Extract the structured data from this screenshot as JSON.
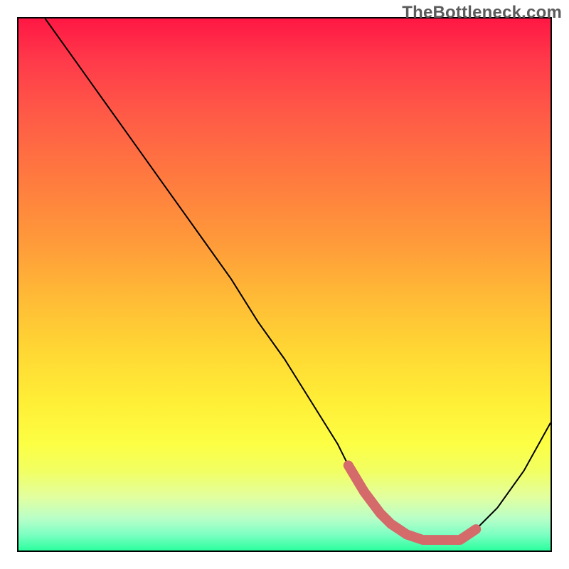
{
  "watermark": "TheBottleneck.com",
  "chart_data": {
    "type": "line",
    "title": "",
    "xlabel": "",
    "ylabel": "",
    "x_range": [
      0,
      100
    ],
    "y_range": [
      0,
      100
    ],
    "grid": false,
    "legend": false,
    "curve": {
      "name": "bottleneck-curve",
      "x": [
        5,
        10,
        15,
        20,
        25,
        30,
        35,
        40,
        45,
        50,
        55,
        60,
        62,
        65,
        68,
        70,
        73,
        76,
        80,
        83,
        86,
        90,
        95,
        100
      ],
      "y": [
        100,
        93,
        86,
        79,
        72,
        65,
        58,
        51,
        43,
        36,
        28,
        20,
        16,
        11,
        7,
        5,
        3,
        2,
        2,
        2,
        4,
        8,
        15,
        24
      ]
    },
    "highlight_segment": {
      "name": "optimal-range",
      "x": [
        62,
        65,
        68,
        70,
        73,
        76,
        80,
        83,
        86
      ],
      "y": [
        16,
        11,
        7,
        5,
        3,
        2,
        2,
        2,
        4
      ],
      "color": "#d46a6a"
    },
    "background_gradient": {
      "top_color": "#ff1744",
      "mid_color": "#ffee36",
      "bottom_color": "#2bff9e"
    }
  }
}
